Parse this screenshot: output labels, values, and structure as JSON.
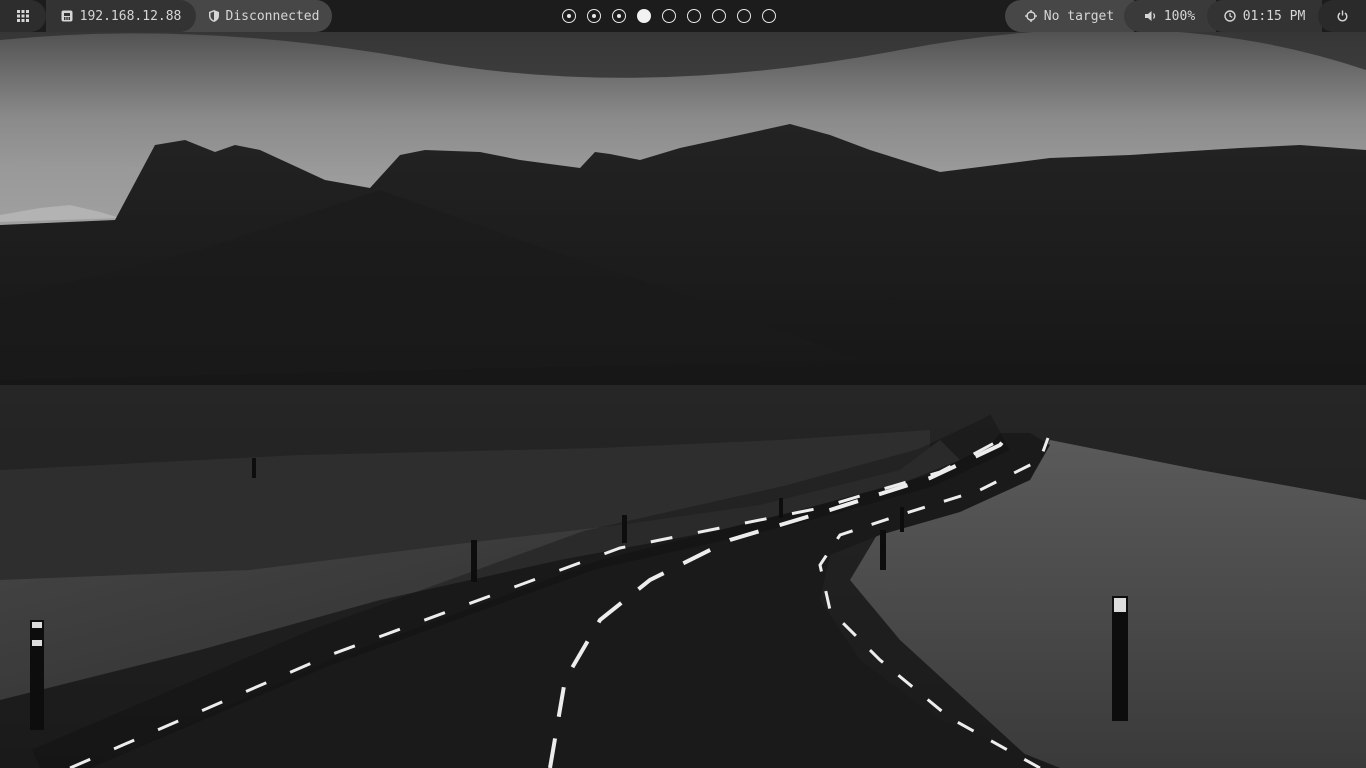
{
  "topbar": {
    "menu_icon": "grid-icon",
    "ip": {
      "icon": "network-card-icon",
      "label": "192.168.12.88"
    },
    "vpn": {
      "icon": "shield-icon",
      "label": "Disconnected"
    },
    "workspaces": [
      {
        "index": 1,
        "state": "occupied"
      },
      {
        "index": 2,
        "state": "occupied"
      },
      {
        "index": 3,
        "state": "occupied"
      },
      {
        "index": 4,
        "state": "active"
      },
      {
        "index": 5,
        "state": "empty"
      },
      {
        "index": 6,
        "state": "empty"
      },
      {
        "index": 7,
        "state": "empty"
      },
      {
        "index": 8,
        "state": "empty"
      },
      {
        "index": 9,
        "state": "empty"
      }
    ],
    "target": {
      "icon": "crosshair-icon",
      "label": "No target"
    },
    "volume": {
      "icon": "speaker-icon",
      "label": "100%"
    },
    "clock": {
      "icon": "clock-icon",
      "label": "01:15 PM"
    },
    "power_icon": "power-icon"
  },
  "wallpaper": {
    "description_icon": "mountain-road-wallpaper",
    "colors": {
      "sky": "#6f6f6f",
      "mountains": "#1e1e1e",
      "field": "#2c2c2c",
      "road": "#161616",
      "markings": "#ededed"
    }
  }
}
